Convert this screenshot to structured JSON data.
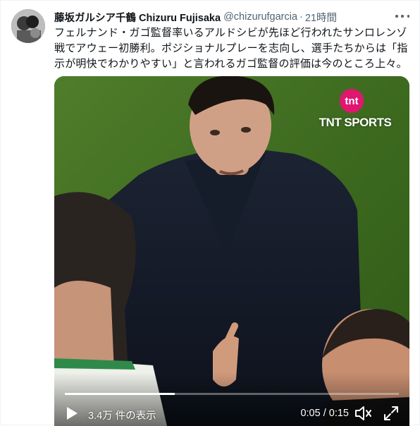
{
  "tweet": {
    "display_name": "藤坂ガルシア千鶴 Chizuru Fujisaka",
    "handle": "@chizurufgarcia",
    "separator": "·",
    "timestamp": "21時間",
    "text_lines": [
      "フェルナンド・ガゴ監督率いるアルドシビが先ほど行われたサンロレンゾ",
      "戦でアウェー初勝利。ポジショナルプレーを志向し、選手たちからは「指",
      "示が明快でわかりやすい」と言われるガゴ監督の評価は今のところ上々。"
    ]
  },
  "video": {
    "logo_text": "TNT SPORTS",
    "logo_mark": "tnt",
    "views_label": "3.4万 件の表示",
    "time_label": "0:05 / 0:15",
    "progress_fraction": 0.33,
    "icons": [
      "play-icon",
      "volume-icon",
      "fullscreen-icon"
    ]
  },
  "colors": {
    "secondary_text": "#536471",
    "logo_pink": "#e0166f"
  }
}
